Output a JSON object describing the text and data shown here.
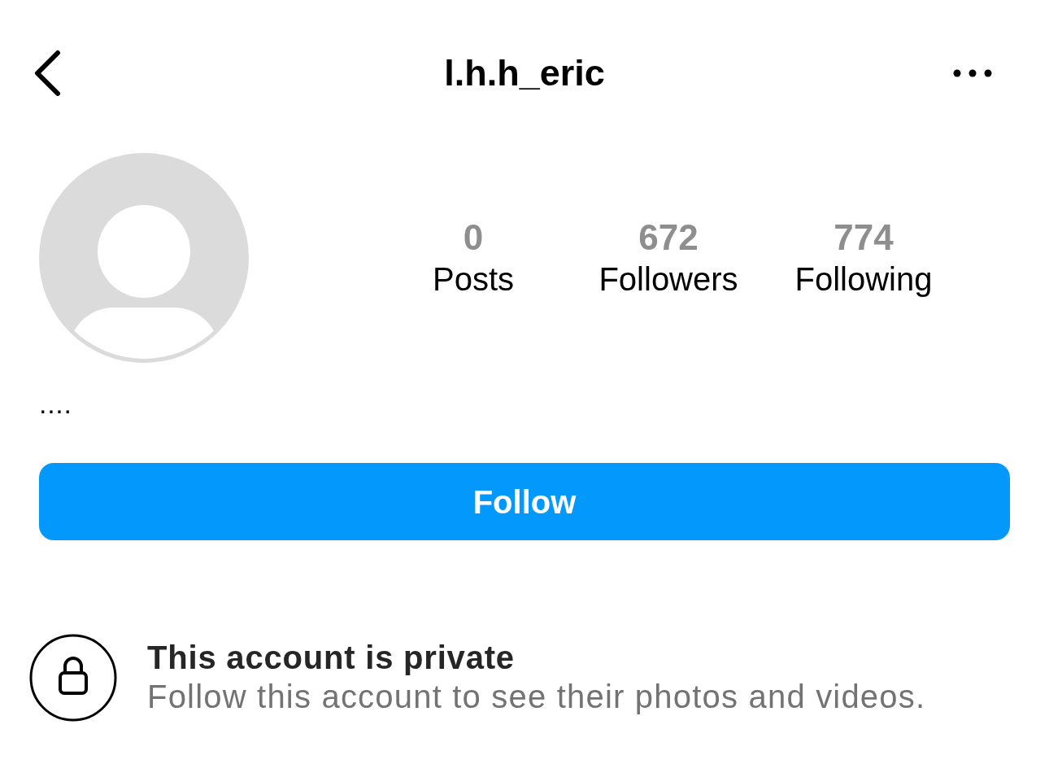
{
  "header": {
    "title": "l.h.h_eric"
  },
  "profile": {
    "stats": [
      {
        "value": "0",
        "label": "Posts"
      },
      {
        "value": "672",
        "label": "Followers"
      },
      {
        "value": "774",
        "label": "Following"
      }
    ],
    "bio": "...."
  },
  "follow_button": {
    "label": "Follow"
  },
  "private_notice": {
    "title": "This account is private",
    "subtitle": "Follow this account to see their photos and videos."
  }
}
